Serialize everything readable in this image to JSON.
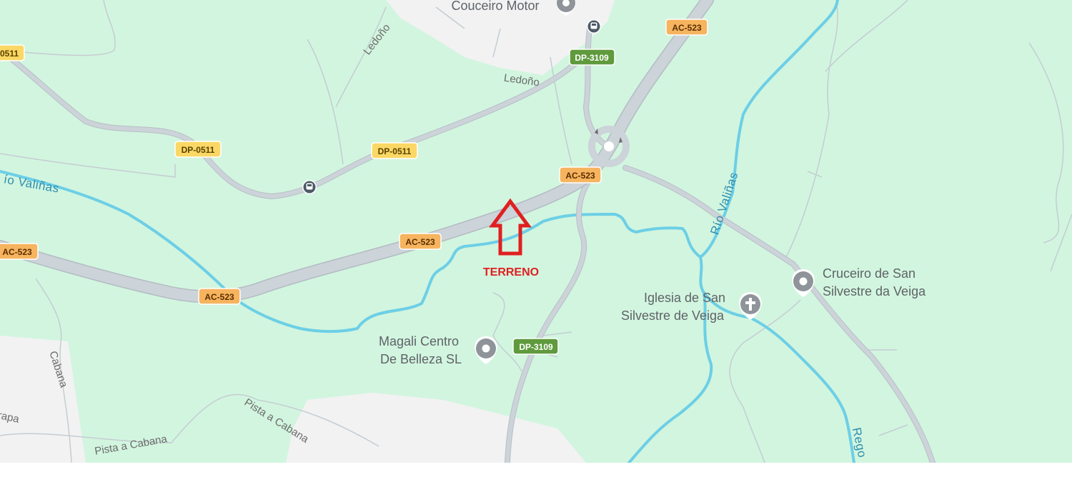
{
  "map": {
    "colors": {
      "land": "#d2f5df",
      "urban": "#f2f2f3",
      "road": "#ccd3d9",
      "minor_road": "#c4cdd2",
      "river": "#6ccfe6",
      "badge_yellow": "#fbd865",
      "badge_orange": "#f6b45f",
      "badge_green": "#5f9a3d",
      "marker_red": "#e02020",
      "poi_gray": "#8e9499"
    },
    "road_badges": {
      "dp0511_left": "0511",
      "dp0511_a": "DP-0511",
      "dp0511_b": "DP-0511",
      "ac523_top": "AC-523",
      "ac523_mid": "AC-523",
      "ac523_center": "AC-523",
      "ac523_left": "AC-523",
      "ac523_low": "AC-523",
      "dp3109_top": "DP-3109",
      "dp3109_bottom": "DP-3109"
    },
    "places": {
      "couceiro_motor": "Couceiro Motor",
      "ledono_place": "Ledoño",
      "ledono_street": "Ledoño",
      "cabana": "Cabana",
      "rapa": "rapa",
      "pista_cabana_1": "Pista a Cabana",
      "pista_cabana_2": "Pista a Cabana"
    },
    "rivers": {
      "valinas_left": "ío Valiñas",
      "valinas_right": "Río Valiñas",
      "rego": "Rego"
    },
    "pois": {
      "magali": [
        "Magali Centro",
        "De Belleza SL"
      ],
      "iglesia": [
        "Iglesia de San",
        "Silvestre de Veiga"
      ],
      "cruceiro": [
        "Cruceiro de San",
        "Silvestre da Veiga"
      ]
    },
    "marker": {
      "label": "TERRENO"
    },
    "icons": [
      "bus-stop-icon",
      "place-pin-icon",
      "church-icon",
      "up-arrow-icon"
    ]
  }
}
